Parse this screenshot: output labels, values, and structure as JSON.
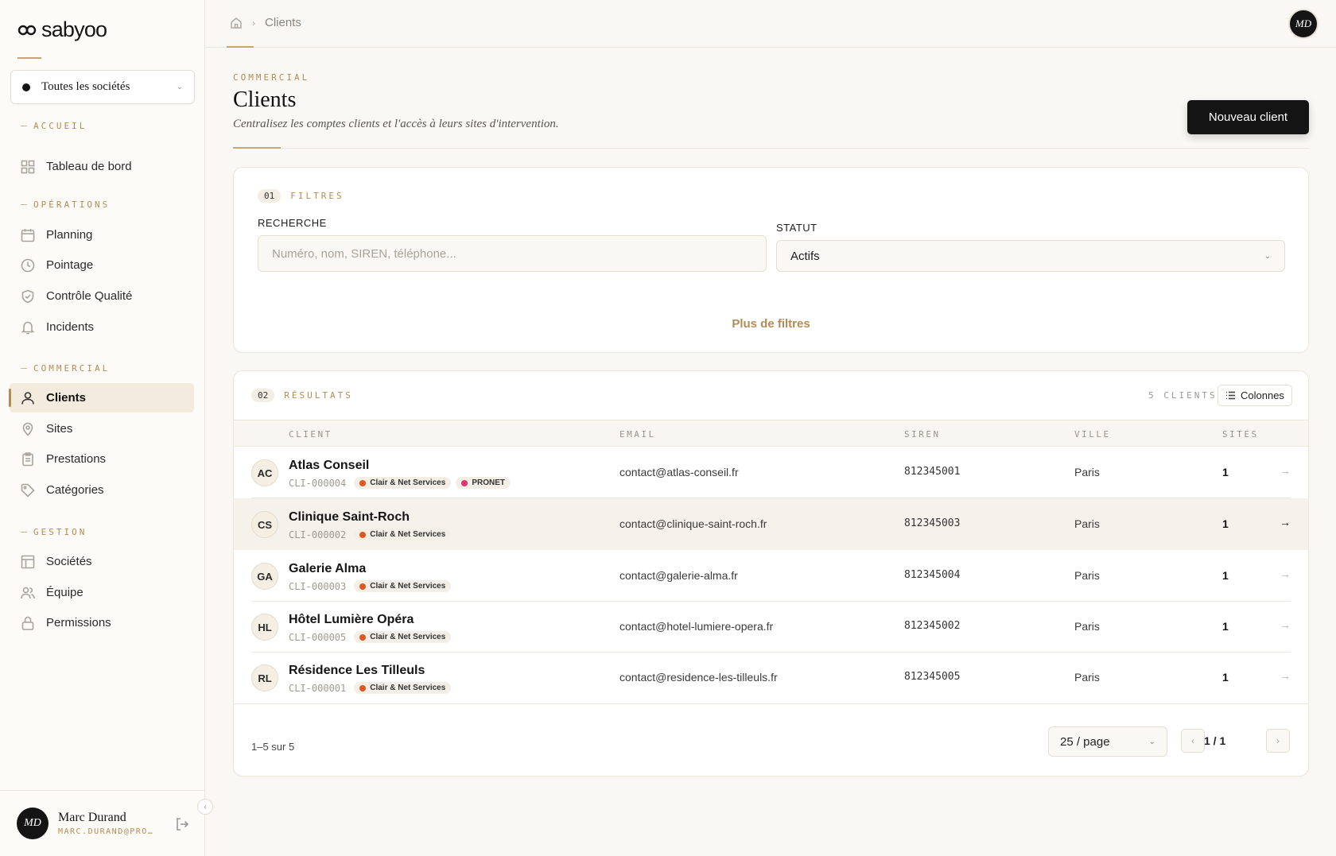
{
  "app": {
    "logo_text": "sabyoo",
    "company_select": "Toutes les sociétés"
  },
  "sidebar": {
    "sections": [
      {
        "label": "ACCUEIL"
      },
      {
        "label": "OPÉRATIONS"
      },
      {
        "label": "COMMERCIAL"
      },
      {
        "label": "GESTION"
      }
    ],
    "items": [
      {
        "label": "Tableau de bord",
        "icon": "dashboard-icon"
      },
      {
        "label": "Planning",
        "icon": "calendar-icon"
      },
      {
        "label": "Pointage",
        "icon": "clock-icon"
      },
      {
        "label": "Contrôle Qualité",
        "icon": "shield-check-icon"
      },
      {
        "label": "Incidents",
        "icon": "bell-icon"
      },
      {
        "label": "Clients",
        "icon": "user-icon",
        "active": true
      },
      {
        "label": "Sites",
        "icon": "map-pin-icon"
      },
      {
        "label": "Prestations",
        "icon": "clipboard-icon"
      },
      {
        "label": "Catégories",
        "icon": "tag-icon"
      },
      {
        "label": "Sociétés",
        "icon": "building-icon"
      },
      {
        "label": "Équipe",
        "icon": "users-icon"
      },
      {
        "label": "Permissions",
        "icon": "lock-icon"
      }
    ],
    "user": {
      "initials": "MD",
      "name": "Marc Durand",
      "email": "MARC.DURAND@PRO…"
    }
  },
  "topbar": {
    "breadcrumb_current": "Clients",
    "avatar_initials": "MD"
  },
  "header": {
    "eyebrow": "COMMERCIAL",
    "title": "Clients",
    "subtitle": "Centralisez les comptes clients et l'accès à leurs sites d'intervention.",
    "new_button": "Nouveau client"
  },
  "filters": {
    "number": "01",
    "label": "FILTRES",
    "search_label": "RECHERCHE",
    "search_placeholder": "Numéro, nom, SIREN, téléphone...",
    "status_label": "STATUT",
    "status_value": "Actifs",
    "more_filters": "Plus de filtres"
  },
  "results": {
    "number": "02",
    "label": "RÉSULTATS",
    "count": "5 CLIENTS",
    "columns_button": "Colonnes",
    "columns": [
      "CLIENT",
      "EMAIL",
      "SIREN",
      "VILLE",
      "SITES"
    ],
    "rows": [
      {
        "initials": "AC",
        "name": "Atlas Conseil",
        "code": "CLI-000004",
        "tags": [
          {
            "label": "Clair & Net Services",
            "color": "#e2571e"
          },
          {
            "label": "PRONET",
            "color": "#e0336f"
          }
        ],
        "email": "contact@atlas-conseil.fr",
        "siren": "812345001",
        "city": "Paris",
        "sites": "1"
      },
      {
        "initials": "CS",
        "name": "Clinique Saint-Roch",
        "code": "CLI-000002",
        "tags": [
          {
            "label": "Clair & Net Services",
            "color": "#e2571e"
          }
        ],
        "email": "contact@clinique-saint-roch.fr",
        "siren": "812345003",
        "city": "Paris",
        "sites": "1"
      },
      {
        "initials": "GA",
        "name": "Galerie Alma",
        "code": "CLI-000003",
        "tags": [
          {
            "label": "Clair & Net Services",
            "color": "#e2571e"
          }
        ],
        "email": "contact@galerie-alma.fr",
        "siren": "812345004",
        "city": "Paris",
        "sites": "1"
      },
      {
        "initials": "HL",
        "name": "Hôtel Lumière Opéra",
        "code": "CLI-000005",
        "tags": [
          {
            "label": "Clair & Net Services",
            "color": "#e2571e"
          }
        ],
        "email": "contact@hotel-lumiere-opera.fr",
        "siren": "812345002",
        "city": "Paris",
        "sites": "1"
      },
      {
        "initials": "RL",
        "name": "Résidence Les Tilleuls",
        "code": "CLI-000001",
        "tags": [
          {
            "label": "Clair & Net Services",
            "color": "#e2571e"
          }
        ],
        "email": "contact@residence-les-tilleuls.fr",
        "siren": "812345005",
        "city": "Paris",
        "sites": "1"
      }
    ],
    "range_text": "1–5 sur 5",
    "page_size": "25 / page",
    "page_indicator": "1 / 1"
  },
  "colors": {
    "accent": "#b48c52",
    "primary": "#141414",
    "background": "#faf8f4"
  }
}
